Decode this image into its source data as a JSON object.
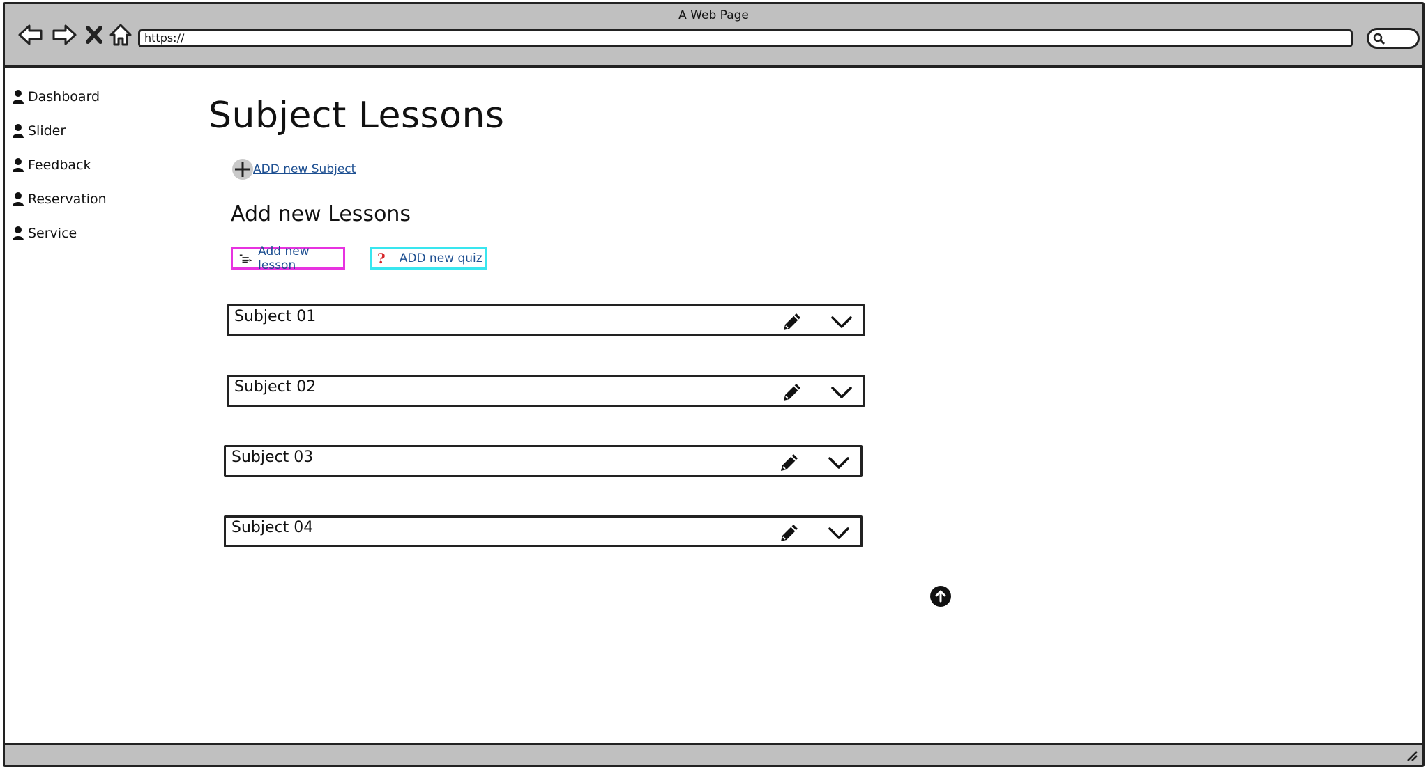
{
  "window": {
    "title": "A Web Page",
    "url": "https://"
  },
  "sidebar": {
    "items": [
      {
        "label": "Dashboard",
        "icon": "user-icon"
      },
      {
        "label": "Slider",
        "icon": "user-icon"
      },
      {
        "label": "Feedback",
        "icon": "user-icon"
      },
      {
        "label": "Reservation",
        "icon": "user-icon"
      },
      {
        "label": "Service",
        "icon": "user-icon"
      }
    ]
  },
  "main": {
    "title": "Subject Lessons",
    "add_subject_label": "ADD new Subject",
    "section_title": "Add new Lessons",
    "add_lesson_label": "Add new lesson",
    "add_quiz_label": "ADD new quiz",
    "subjects": [
      {
        "label": "Subject 01"
      },
      {
        "label": "Subject 02"
      },
      {
        "label": "Subject 03"
      },
      {
        "label": "Subject 04"
      }
    ]
  },
  "colors": {
    "chrome": "#c0c0c0",
    "link": "#1d4f91",
    "lesson_border": "#e733e0",
    "quiz_border": "#39e6ef",
    "quiz_icon": "#d6262a"
  }
}
